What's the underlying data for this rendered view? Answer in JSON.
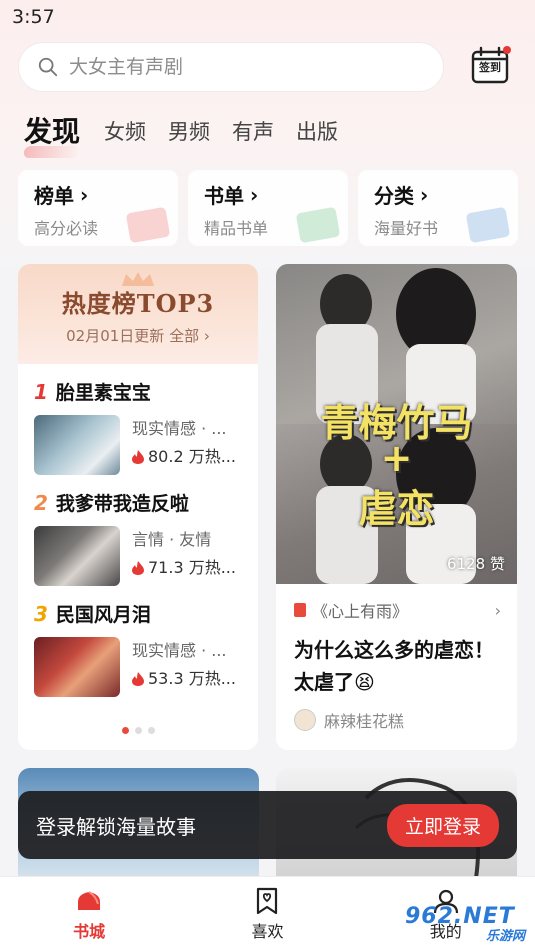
{
  "status_bar": {
    "time": "3:57"
  },
  "search": {
    "placeholder": "大女主有声剧",
    "icon": "search-icon"
  },
  "checkin": {
    "label": "签到",
    "icon": "calendar-icon",
    "badge_color": "#e53935"
  },
  "tabs": [
    {
      "label": "发现",
      "active": true
    },
    {
      "label": "女频"
    },
    {
      "label": "男频"
    },
    {
      "label": "有声"
    },
    {
      "label": "出版"
    }
  ],
  "quick_links": [
    {
      "title": "榜单",
      "subtitle": "高分必读"
    },
    {
      "title": "书单",
      "subtitle": "精品书单"
    },
    {
      "title": "分类",
      "subtitle": "海量好书"
    }
  ],
  "ranking": {
    "title": "热度榜TOP3",
    "update": "02月01日更新 全部",
    "items": [
      {
        "rank": "1",
        "title": "胎里素宝宝",
        "tags": "现实情感 · ...",
        "heat": "80.2 万热..."
      },
      {
        "rank": "2",
        "title": "我爹带我造反啦",
        "tags": "言情 · 友情",
        "heat": "71.3 万热..."
      },
      {
        "rank": "3",
        "title": "民国风月泪",
        "tags": "现实情感 · ...",
        "heat": "53.3 万热..."
      }
    ],
    "page_indicator": {
      "active": 0,
      "count": 3
    }
  },
  "post": {
    "headline_line1": "青梅竹马",
    "headline_line2": "+",
    "headline_line3": "虐恋",
    "likes": "6128 赞",
    "book": "《心上有雨》",
    "title": "为什么这么多的虐恋！太虐了",
    "emoji": "😫",
    "author": "麻辣桂花糕"
  },
  "login_prompt": {
    "text": "登录解锁海量故事",
    "button": "立即登录"
  },
  "bottom_nav": [
    {
      "label": "书城",
      "icon": "bookstore-icon",
      "active": true
    },
    {
      "label": "喜欢",
      "icon": "bookmark-heart-icon"
    },
    {
      "label": "我的",
      "icon": "profile-icon"
    }
  ],
  "watermark": {
    "main": "962.NET",
    "sub": "乐游网"
  },
  "colors": {
    "accent": "#e53935",
    "rank1": "#e53935",
    "rank2": "#f08a4b",
    "rank3": "#f0a500"
  }
}
